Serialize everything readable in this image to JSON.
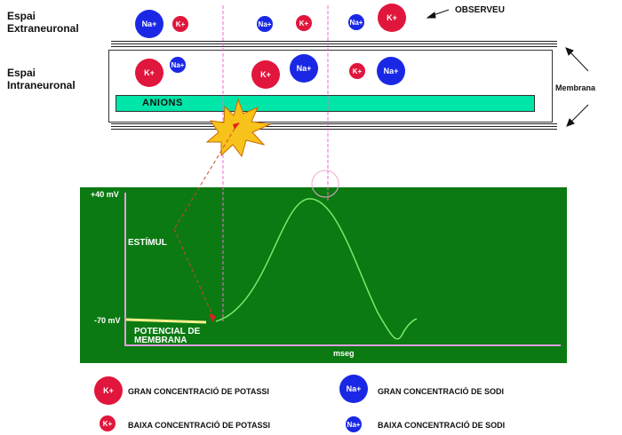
{
  "labels": {
    "extra_line1": "Espai",
    "extra_line2": "Extraneuronal",
    "intra_line1": "Espai",
    "intra_line2": "Intraneuronal",
    "observeu": "OBSERVEU",
    "membrana": "Membrana",
    "anions": "ANIONS"
  },
  "ions": {
    "k": "K+",
    "na": "Na+"
  },
  "graph": {
    "y_top": "+40 mV",
    "y_bottom": "-70 mV",
    "x_label": "mseg",
    "estimul": "ESTÍMUL",
    "potencial_line1": "POTENCIAL DE",
    "potencial_line2": "MEMBRANA"
  },
  "legend": {
    "gran_k": "GRAN CONCENTRACIÓ DE POTASSI",
    "gran_na": "GRAN CONCENTRACIÓ DE SODI",
    "baixa_k": "BAIXA CONCENTRACIÓ DE POTASSI",
    "baixa_na": "BAIXA CONCENTRACIÓ DE SODI"
  },
  "colors": {
    "potassium": "#e0163c",
    "sodium": "#1a28e6",
    "anions": "#00e5a8",
    "graph_bg": "#0b7a12",
    "curve": "#7de86a",
    "resting": "#f6f08a",
    "axis": "#e0a0e0",
    "stimulus": "#f7c21a"
  }
}
